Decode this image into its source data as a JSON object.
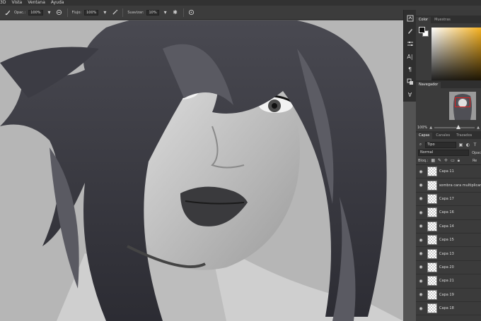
{
  "menubar": {
    "items": [
      "3D",
      "Vista",
      "Ventana",
      "Ayuda"
    ]
  },
  "options": {
    "opacity_label": "Opac.:",
    "opacity_value": "100%",
    "flow_label": "Flujo:",
    "flow_value": "100%",
    "smooth_label": "Suavizar:",
    "smooth_value": "10%"
  },
  "color_panel": {
    "tabs": [
      "Color",
      "Muestras"
    ],
    "accent": "#f6b221"
  },
  "navigator": {
    "tab": "Navegador",
    "zoom": "100%"
  },
  "layers_panel": {
    "tabs": [
      "Capas",
      "Canales",
      "Trazados"
    ],
    "filter": "Tipo",
    "blend_mode": "Normal",
    "opacity_label": "Opac",
    "lock_label": "Bloq.:",
    "fill_label": "Re",
    "layers": [
      {
        "name": "Capa 11"
      },
      {
        "name": "sombra cara multiplicar"
      },
      {
        "name": "Capa 17"
      },
      {
        "name": "Capa 16"
      },
      {
        "name": "Capa 14"
      },
      {
        "name": "Capa 15"
      },
      {
        "name": "Capa 13"
      },
      {
        "name": "Capa 20"
      },
      {
        "name": "Capa 21"
      },
      {
        "name": "Capa 19"
      },
      {
        "name": "Capa 18"
      }
    ]
  }
}
